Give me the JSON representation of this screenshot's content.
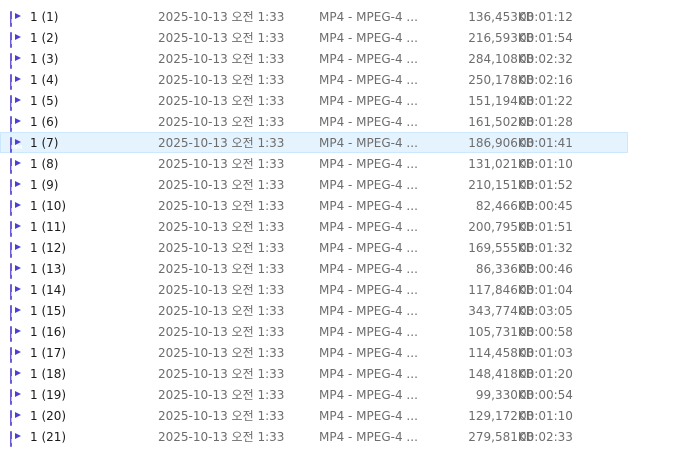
{
  "icon": {
    "name": "mp4-video-file-icon",
    "label": "MP4",
    "color": "#4b3cc9"
  },
  "selected_index": 6,
  "files": [
    {
      "name": "1 (1)",
      "date": "2025-10-13 오전 1:33",
      "type": "MP4 - MPEG-4 ...",
      "size": "136,453KB",
      "length": "00:01:12"
    },
    {
      "name": "1 (2)",
      "date": "2025-10-13 오전 1:33",
      "type": "MP4 - MPEG-4 ...",
      "size": "216,593KB",
      "length": "00:01:54"
    },
    {
      "name": "1 (3)",
      "date": "2025-10-13 오전 1:33",
      "type": "MP4 - MPEG-4 ...",
      "size": "284,108KB",
      "length": "00:02:32"
    },
    {
      "name": "1 (4)",
      "date": "2025-10-13 오전 1:33",
      "type": "MP4 - MPEG-4 ...",
      "size": "250,178KB",
      "length": "00:02:16"
    },
    {
      "name": "1 (5)",
      "date": "2025-10-13 오전 1:33",
      "type": "MP4 - MPEG-4 ...",
      "size": "151,194KB",
      "length": "00:01:22"
    },
    {
      "name": "1 (6)",
      "date": "2025-10-13 오전 1:33",
      "type": "MP4 - MPEG-4 ...",
      "size": "161,502KB",
      "length": "00:01:28"
    },
    {
      "name": "1 (7)",
      "date": "2025-10-13 오전 1:33",
      "type": "MP4 - MPEG-4 ...",
      "size": "186,906KB",
      "length": "00:01:41"
    },
    {
      "name": "1 (8)",
      "date": "2025-10-13 오전 1:33",
      "type": "MP4 - MPEG-4 ...",
      "size": "131,021KB",
      "length": "00:01:10"
    },
    {
      "name": "1 (9)",
      "date": "2025-10-13 오전 1:33",
      "type": "MP4 - MPEG-4 ...",
      "size": "210,151KB",
      "length": "00:01:52"
    },
    {
      "name": "1 (10)",
      "date": "2025-10-13 오전 1:33",
      "type": "MP4 - MPEG-4 ...",
      "size": "82,466KB",
      "length": "00:00:45"
    },
    {
      "name": "1 (11)",
      "date": "2025-10-13 오전 1:33",
      "type": "MP4 - MPEG-4 ...",
      "size": "200,795KB",
      "length": "00:01:51"
    },
    {
      "name": "1 (12)",
      "date": "2025-10-13 오전 1:33",
      "type": "MP4 - MPEG-4 ...",
      "size": "169,555KB",
      "length": "00:01:32"
    },
    {
      "name": "1 (13)",
      "date": "2025-10-13 오전 1:33",
      "type": "MP4 - MPEG-4 ...",
      "size": "86,336KB",
      "length": "00:00:46"
    },
    {
      "name": "1 (14)",
      "date": "2025-10-13 오전 1:33",
      "type": "MP4 - MPEG-4 ...",
      "size": "117,846KB",
      "length": "00:01:04"
    },
    {
      "name": "1 (15)",
      "date": "2025-10-13 오전 1:33",
      "type": "MP4 - MPEG-4 ...",
      "size": "343,774KB",
      "length": "00:03:05"
    },
    {
      "name": "1 (16)",
      "date": "2025-10-13 오전 1:33",
      "type": "MP4 - MPEG-4 ...",
      "size": "105,731KB",
      "length": "00:00:58"
    },
    {
      "name": "1 (17)",
      "date": "2025-10-13 오전 1:33",
      "type": "MP4 - MPEG-4 ...",
      "size": "114,458KB",
      "length": "00:01:03"
    },
    {
      "name": "1 (18)",
      "date": "2025-10-13 오전 1:33",
      "type": "MP4 - MPEG-4 ...",
      "size": "148,418KB",
      "length": "00:01:20"
    },
    {
      "name": "1 (19)",
      "date": "2025-10-13 오전 1:33",
      "type": "MP4 - MPEG-4 ...",
      "size": "99,330KB",
      "length": "00:00:54"
    },
    {
      "name": "1 (20)",
      "date": "2025-10-13 오전 1:33",
      "type": "MP4 - MPEG-4 ...",
      "size": "129,172KB",
      "length": "00:01:10"
    },
    {
      "name": "1 (21)",
      "date": "2025-10-13 오전 1:33",
      "type": "MP4 - MPEG-4 ...",
      "size": "279,581KB",
      "length": "00:02:33"
    }
  ]
}
